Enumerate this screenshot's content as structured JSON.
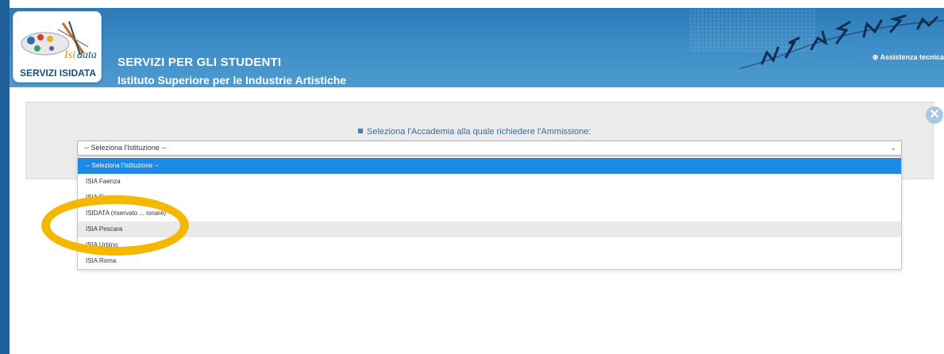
{
  "header": {
    "logo_text": "SERVIZI ISIDATA",
    "logo_wordmark": "Isidata",
    "title": "SERVIZI PER GLI STUDENTI",
    "subtitle": "Istituto Superiore per le Industrie Artistiche",
    "assistance_link": "⊕ Assistenza tecnica"
  },
  "panel": {
    "prompt": "Seleziona l'Accademia alla quale richiedere l'Ammissione:",
    "close_symbol": "✕",
    "select": {
      "value": "-- Seleziona l'Istituzione --",
      "options": [
        "-- Seleziona l'Istituzione --",
        "ISIA Faenza",
        "ISIA Firenze",
        "ISIDATA (riservato ... ionare)",
        "ISIA Pescara",
        "ISIA Urbino",
        "ISIA Roma"
      ],
      "selected_index": 0,
      "hovered_index": 4
    }
  },
  "colors": {
    "header_blue": "#2b7ab8",
    "selection_blue": "#1e88e5",
    "highlight_yellow": "#f5b800"
  }
}
